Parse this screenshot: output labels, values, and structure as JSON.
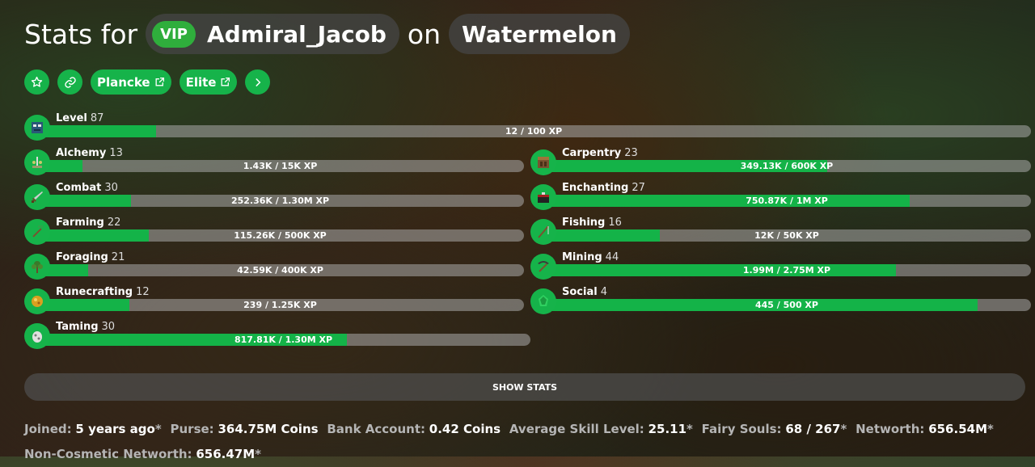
{
  "header": {
    "prefix": "Stats for",
    "rank": "VIP",
    "player": "Admiral_Jacob",
    "connector": "on",
    "profile": "Watermelon"
  },
  "buttons": {
    "plancke": "Plancke",
    "elite": "Elite"
  },
  "colors": {
    "accent": "#14b348",
    "track": "#aaaaaa"
  },
  "level": {
    "label": "Level",
    "value": "87",
    "xp": "12 / 100 XP",
    "progress": 0.12,
    "icon": "player-head-icon"
  },
  "skills_left": [
    {
      "name": "Alchemy",
      "level": "13",
      "xp": "1.43K / 15K XP",
      "progress": 0.095,
      "icon": "brewing-stand-icon"
    },
    {
      "name": "Combat",
      "level": "30",
      "xp": "252.36K / 1.30M XP",
      "progress": 0.194,
      "icon": "sword-icon"
    },
    {
      "name": "Farming",
      "level": "22",
      "xp": "115.26K / 500K XP",
      "progress": 0.23,
      "icon": "hoe-icon"
    },
    {
      "name": "Foraging",
      "level": "21",
      "xp": "42.59K / 400K XP",
      "progress": 0.106,
      "icon": "sapling-icon"
    },
    {
      "name": "Runecrafting",
      "level": "12",
      "xp": "239 / 1.25K XP",
      "progress": 0.191,
      "icon": "magma-cream-icon"
    },
    {
      "name": "Taming",
      "level": "30",
      "xp": "817.81K / 1.30M XP",
      "progress": 0.629,
      "icon": "spawn-egg-icon"
    }
  ],
  "skills_right": [
    {
      "name": "Carpentry",
      "level": "23",
      "xp": "349.13K / 600K XP",
      "progress": 0.582,
      "icon": "crafting-table-icon"
    },
    {
      "name": "Enchanting",
      "level": "27",
      "xp": "750.87K / 1M XP",
      "progress": 0.751,
      "icon": "enchanting-table-icon"
    },
    {
      "name": "Fishing",
      "level": "16",
      "xp": "12K / 50K XP",
      "progress": 0.24,
      "icon": "fishing-rod-icon"
    },
    {
      "name": "Mining",
      "level": "44",
      "xp": "1.99M / 2.75M XP",
      "progress": 0.724,
      "icon": "pickaxe-icon"
    },
    {
      "name": "Social",
      "level": "4",
      "xp": "445 / 500 XP",
      "progress": 0.89,
      "icon": "emerald-icon"
    }
  ],
  "show_stats": "SHOW STATS",
  "info": [
    {
      "key": "Joined:",
      "value": "5 years ago",
      "asterisk": "*"
    },
    {
      "key": "Purse:",
      "value": "364.75M Coins",
      "asterisk": ""
    },
    {
      "key": "Bank Account:",
      "value": "0.42 Coins",
      "asterisk": ""
    },
    {
      "key": "Average Skill Level:",
      "value": "25.11",
      "asterisk": "*"
    },
    {
      "key": "Fairy Souls:",
      "value": "68 / 267",
      "asterisk": "*"
    },
    {
      "key": "Networth:",
      "value": "656.54M",
      "asterisk": "*"
    },
    {
      "key": "Non-Cosmetic Networth:",
      "value": "656.47M",
      "asterisk": "*"
    }
  ]
}
